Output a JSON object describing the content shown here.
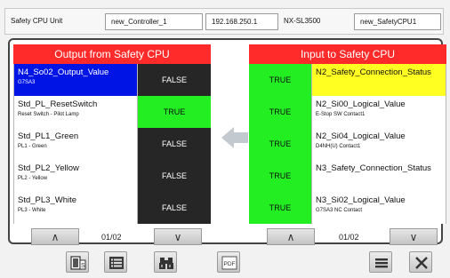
{
  "header": {
    "unit_label": "Safety CPU Unit",
    "controller": "new_Controller_1",
    "ip": "192.168.250.1",
    "model": "NX-SL3500",
    "cpu": "new_SafetyCPU1"
  },
  "output_panel": {
    "title": "Output from Safety CPU",
    "rows": [
      {
        "name": "N4_So02_Output_Value",
        "sub": "G7SA3",
        "value": "FALSE"
      },
      {
        "name": "Std_PL_ResetSwitch",
        "sub": "Reset Switch - Pilot Lamp",
        "value": "TRUE"
      },
      {
        "name": "Std_PL1_Green",
        "sub": "PL1 - Green",
        "value": "FALSE"
      },
      {
        "name": "Std_PL2_Yellow",
        "sub": "PL2 - Yellow",
        "value": "FALSE"
      },
      {
        "name": "Std_PL3_White",
        "sub": "PL3 - White",
        "value": "FALSE"
      }
    ],
    "page": "01/02"
  },
  "input_panel": {
    "title": "Input to Safety CPU",
    "rows": [
      {
        "name": "N2_Safety_Connection_Status",
        "sub": "",
        "value": "TRUE"
      },
      {
        "name": "N2_Si00_Logical_Value",
        "sub": "E-Stop SW Contact1",
        "value": "TRUE"
      },
      {
        "name": "N2_Si04_Logical_Value",
        "sub": "D4NH(U) Contact1",
        "value": "TRUE"
      },
      {
        "name": "N3_Safety_Connection_Status",
        "sub": "",
        "value": "TRUE"
      },
      {
        "name": "N3_Si02_Logical_Value",
        "sub": "G7SA3 NC Contact",
        "value": "TRUE"
      }
    ],
    "page": "01/02"
  },
  "pager": {
    "up": "∧",
    "down": "∨"
  },
  "toolbar": {
    "pdf_label": "PDF"
  },
  "colors": {
    "title_bar": "#ff2a2a",
    "true_cell": "#22ee22",
    "false_cell": "#262626",
    "highlight_blue": "#0014e6",
    "highlight_yellow": "#ffff22"
  }
}
